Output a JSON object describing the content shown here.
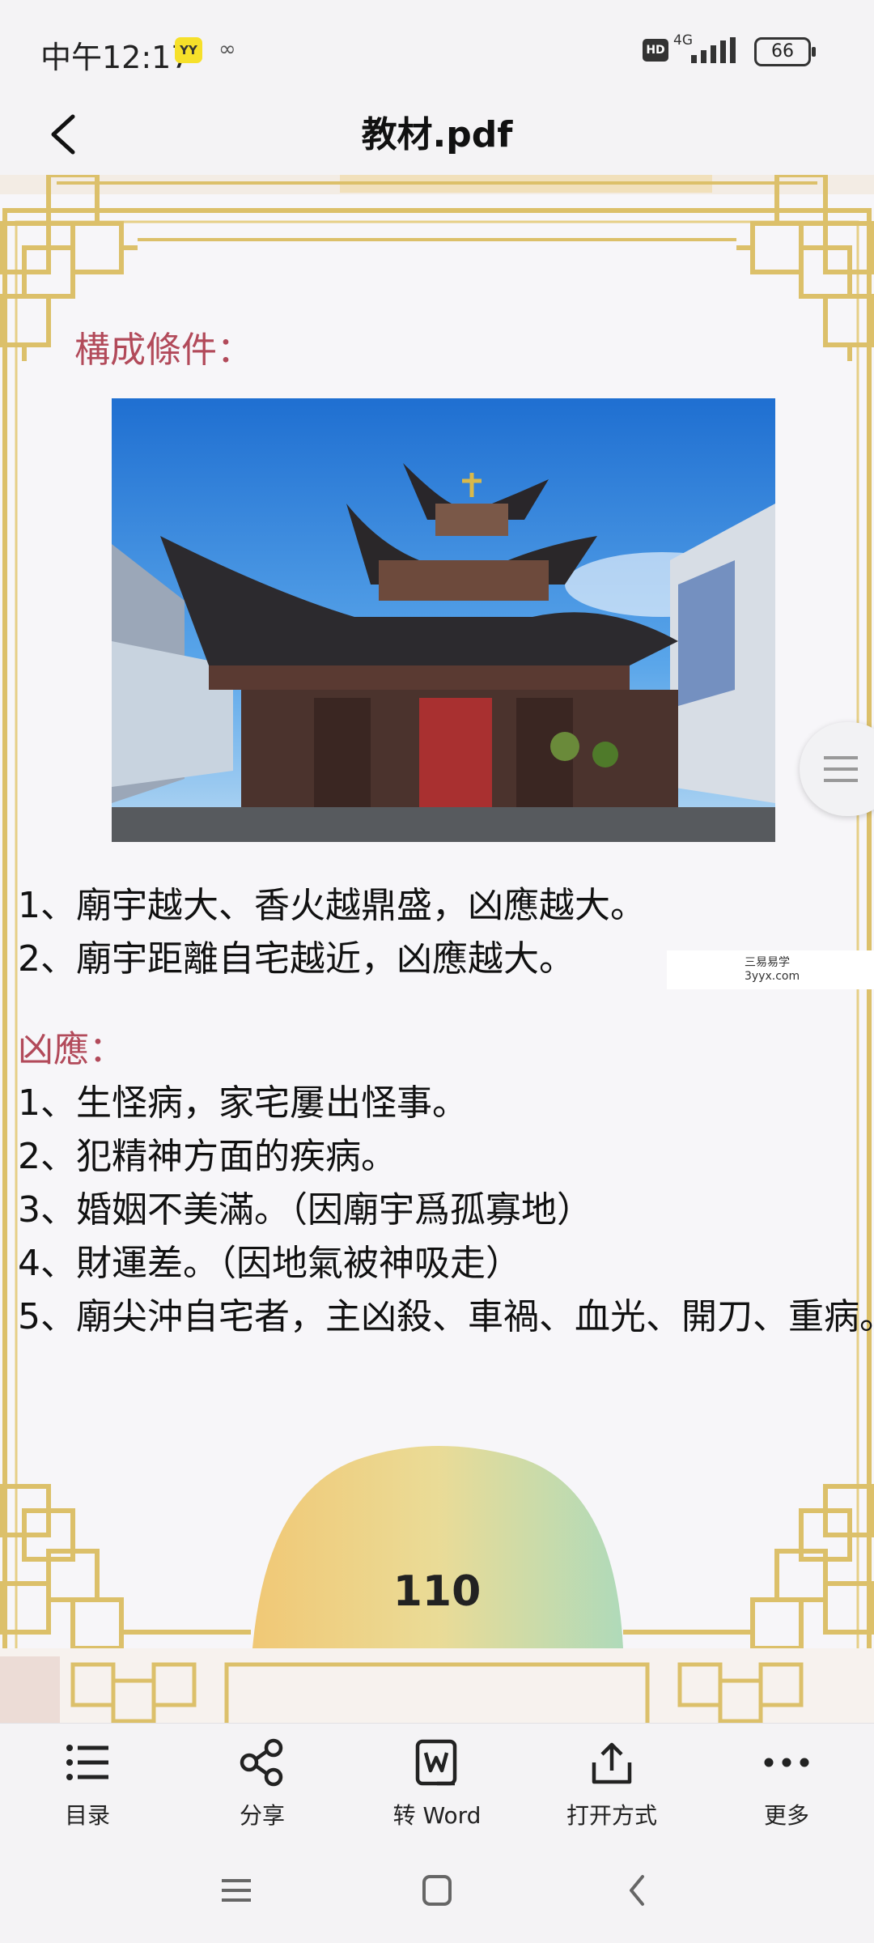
{
  "status_bar": {
    "time": "中午12:17",
    "app_badge": "YY",
    "hd": "HD",
    "network": "4G",
    "battery": "66"
  },
  "header": {
    "title": "教材.pdf",
    "back_icon": "chevron-left-icon"
  },
  "document": {
    "section1_heading": "構成條件：",
    "conditions": [
      "1、廟宇越大、香火越鼎盛，凶應越大。",
      "2、廟宇距離自宅越近，凶應越大。"
    ],
    "section2_heading": "凶應：",
    "effects": [
      "1、生怪病，家宅屢出怪事。",
      "2、犯精神方面的疾病。",
      "3、婚姻不美滿。（因廟宇爲孤寡地）",
      "4、財運差。（因地氣被神吸走）",
      "5、廟尖沖自宅者，主凶殺、車禍、血光、開刀、重病。"
    ],
    "watermark": {
      "line1": "三易易学",
      "line2": "3yyx.com"
    },
    "page_number": "110"
  },
  "toolbar": {
    "items": [
      {
        "label": "目录",
        "icon": "list-icon"
      },
      {
        "label": "分享",
        "icon": "share-icon"
      },
      {
        "label": "转 Word",
        "icon": "word-convert-icon"
      },
      {
        "label": "打开方式",
        "icon": "open-with-icon"
      },
      {
        "label": "更多",
        "icon": "more-icon"
      }
    ]
  },
  "nav_bar": {
    "icons": [
      "menu-icon",
      "home-icon",
      "back-icon"
    ]
  },
  "colors": {
    "heading": "#b24a5a",
    "frame_gold": "#dcc06a",
    "background": "#f4f3f5"
  }
}
